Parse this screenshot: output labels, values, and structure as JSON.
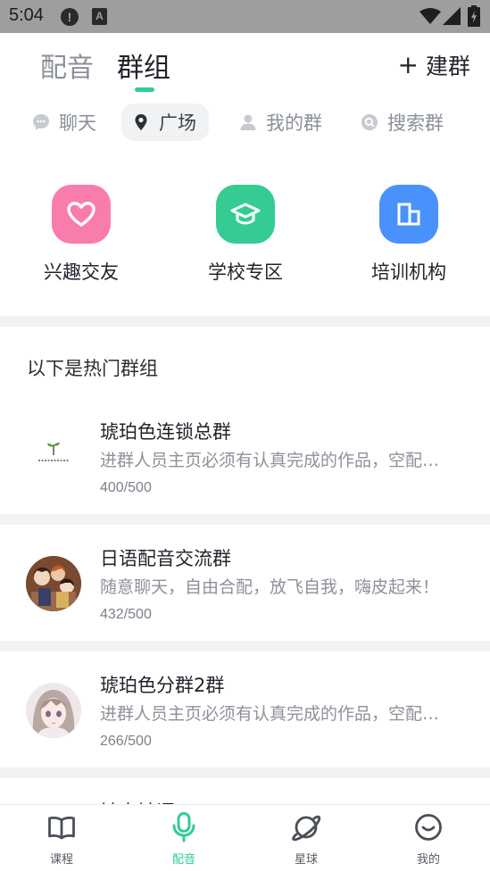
{
  "status_bar": {
    "time": "5:04",
    "alert_glyph": "!",
    "a_glyph": "A",
    "icons": [
      "alert-icon",
      "font-a-icon",
      "wifi-icon",
      "signal-icon",
      "battery-icon"
    ]
  },
  "header": {
    "tabs": [
      {
        "label": "配音",
        "active": false
      },
      {
        "label": "群组",
        "active": true
      }
    ],
    "create_label": "建群",
    "create_icon": "plus-icon",
    "accent_color": "#2ecc9a"
  },
  "subtabs": [
    {
      "label": "聊天",
      "icon": "chat-bubble-icon",
      "active": false
    },
    {
      "label": "广场",
      "icon": "location-pin-icon",
      "active": true
    },
    {
      "label": "我的群",
      "icon": "person-icon",
      "active": false
    },
    {
      "label": "搜索群",
      "icon": "search-icon",
      "active": false
    }
  ],
  "categories": [
    {
      "label": "兴趣交友",
      "icon": "heart-icon",
      "color": "#f97dac"
    },
    {
      "label": "学校专区",
      "icon": "graduation-cap-icon",
      "color": "#35cc93"
    },
    {
      "label": "培训机构",
      "icon": "building-icon",
      "color": "#4a92fb"
    }
  ],
  "section_title": "以下是热门群组",
  "groups": [
    {
      "name": "琥珀色连锁总群",
      "desc": "进群人员主页必须有认真完成的作品，空配…",
      "count": "400/500",
      "avatar": "sprout-logo"
    },
    {
      "name": "日语配音交流群",
      "desc": "随意聊天，自由合配，放飞自我，嗨皮起来！",
      "count": "432/500",
      "avatar": "anime-group-photo"
    },
    {
      "name": "琥珀色分群2群",
      "desc": "进群人员主页必须有认真完成的作品，空配…",
      "count": "266/500",
      "avatar": "anime-girl-portrait"
    },
    {
      "name": "钟声钟语",
      "desc": "",
      "count": "",
      "avatar": ""
    }
  ],
  "bottom_nav": [
    {
      "label": "课程",
      "icon": "book-icon",
      "active": false
    },
    {
      "label": "配音",
      "icon": "microphone-icon",
      "active": true
    },
    {
      "label": "星球",
      "icon": "planet-icon",
      "active": false
    },
    {
      "label": "我的",
      "icon": "smile-face-icon",
      "active": false
    }
  ]
}
